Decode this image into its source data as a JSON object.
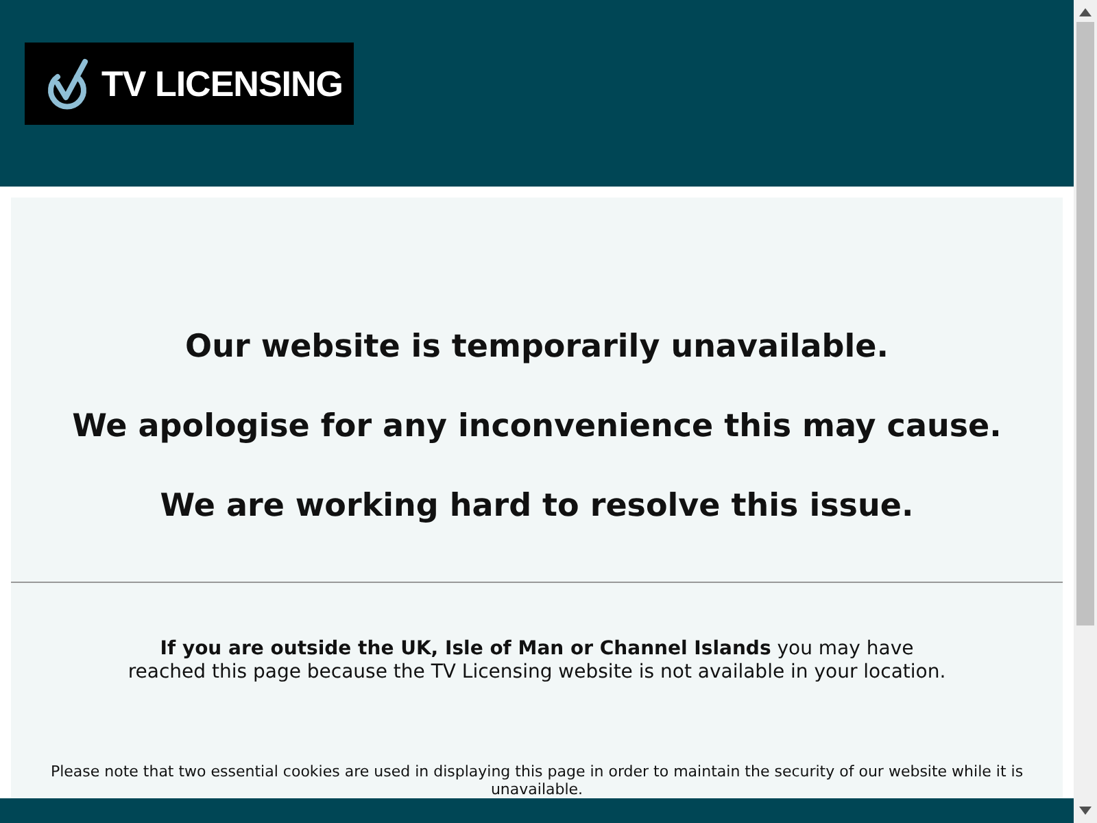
{
  "header": {
    "logo_text": "TV LICENSING"
  },
  "messages": [
    "Our website is temporarily unavailable.",
    "We apologise for any inconvenience this may cause.",
    "We are working hard to resolve this issue."
  ],
  "location_note": "**If you are outside the UK, Isle of Man or Channel Islands** you may have reached this page because the TV Licensing website is not available in your location.",
  "cookie_note": "Please note that two essential cookies are used in displaying this page in order to maintain the security of our website while it is unavailable."
}
